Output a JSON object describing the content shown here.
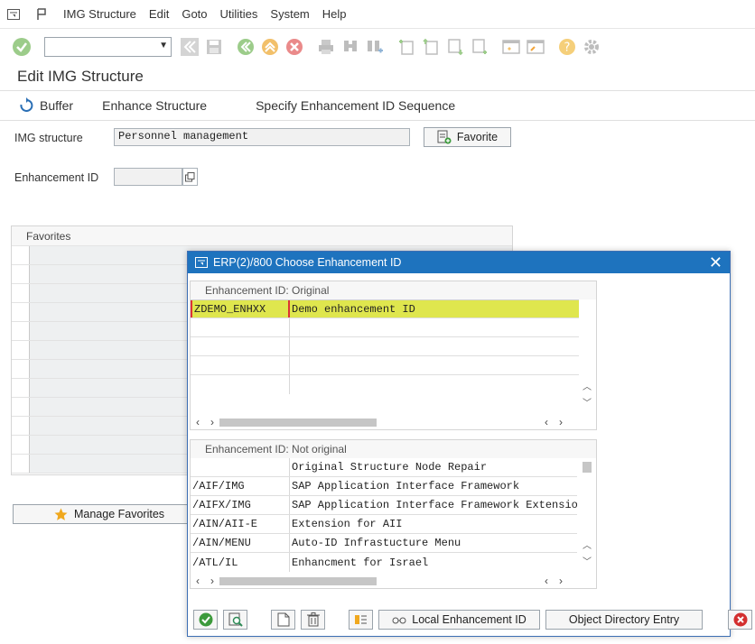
{
  "menu": {
    "items": [
      {
        "label": "IMG Structure"
      },
      {
        "label": "Edit"
      },
      {
        "label": "Goto"
      },
      {
        "label": "Utilities"
      },
      {
        "label": "System"
      },
      {
        "label": "Help"
      }
    ]
  },
  "toolbar": {
    "command_value": ""
  },
  "page": {
    "title": "Edit IMG Structure"
  },
  "appbar": {
    "buffer": "Buffer",
    "enhance": "Enhance Structure",
    "sequence": "Specify Enhancement ID Sequence"
  },
  "form": {
    "img_structure_label": "IMG structure",
    "img_structure_value": "Personnel management",
    "favorite_button": "Favorite",
    "enhancement_id_label": "Enhancement ID",
    "enhancement_id_value": ""
  },
  "favorites": {
    "header": "Favorites",
    "manage_button": "Manage Favorites"
  },
  "dialog": {
    "title": "ERP(2)/800 Choose Enhancement ID",
    "original_header": "Enhancement ID: Original",
    "original_rows": [
      {
        "id": "ZDEMO_ENHXX",
        "desc": "Demo enhancement ID"
      }
    ],
    "not_original_header": "Enhancement ID: Not original",
    "not_original_rows": [
      {
        "id": "",
        "desc": "Original Structure Node Repair"
      },
      {
        "id": "/AIF/IMG",
        "desc": "SAP Application Interface Framework"
      },
      {
        "id": "/AIFX/IMG",
        "desc": "SAP Application Interface Framework Extension"
      },
      {
        "id": "/AIN/AII-E",
        "desc": "Extension for AII"
      },
      {
        "id": "/AIN/MENU",
        "desc": "Auto-ID Infrastucture Menu"
      },
      {
        "id": "/ATL/IL",
        "desc": "Enhancment for Israel"
      }
    ],
    "local_button": "Local Enhancement ID",
    "object_button": "Object Directory Entry"
  }
}
